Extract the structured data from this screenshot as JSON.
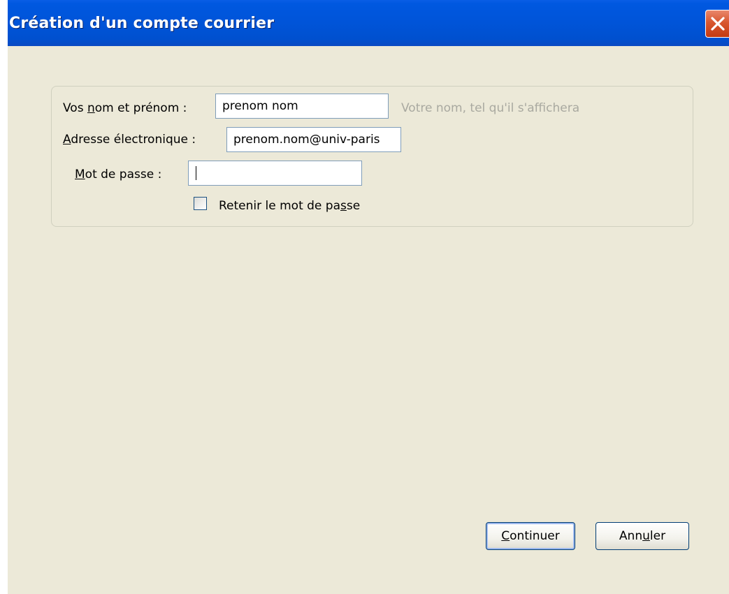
{
  "window": {
    "title": "Création d'un compte courrier",
    "close_icon": "close-icon",
    "colors": {
      "titlebar": "#0054e3",
      "client": "#ece9d8",
      "close": "#d8572f"
    }
  },
  "form": {
    "name_label_pre": "Vos ",
    "name_label_acc": "n",
    "name_label_post": "om et prénom :",
    "name_value": "prenom nom",
    "name_hint": "Votre nom, tel qu'il s'affichera",
    "email_label_acc": "A",
    "email_label_post": "dresse électronique :",
    "email_value": "prenom.nom@univ-paris",
    "password_label_acc": "M",
    "password_label_post": "ot de passe :",
    "password_value": "",
    "remember_pre": "Retenir le mot de pa",
    "remember_acc": "s",
    "remember_post": "se",
    "remember_checked": false
  },
  "buttons": {
    "continue_acc": "C",
    "continue_post": "ontinuer",
    "cancel_pre": "Ann",
    "cancel_acc": "u",
    "cancel_post": "ler"
  }
}
